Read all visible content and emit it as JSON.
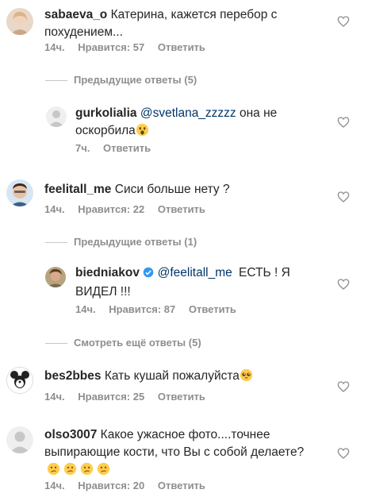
{
  "comments": [
    {
      "username": "sabaeva_o",
      "text": "Катерина, кажется перебор с похудением...",
      "time": "14ч.",
      "likes": "Нравится: 57",
      "reply": "Ответить"
    },
    {
      "username": "gurkolialia",
      "mention": "@svetlana_zzzzz",
      "text": "она не оскорбила",
      "time": "7ч.",
      "reply": "Ответить"
    },
    {
      "username": "feelitall_me",
      "text": "Сиси больше нету ?",
      "time": "14ч.",
      "likes": "Нравится: 22",
      "reply": "Ответить"
    },
    {
      "username": "biedniakov",
      "mention": "@feelitall_me",
      "text": "ЕСТЬ ! Я ВИДЕЛ !!!",
      "time": "14ч.",
      "likes": "Нравится: 87",
      "reply": "Ответить"
    },
    {
      "username": "bes2bbes",
      "text": "Кать кушай пожалуйста",
      "time": "14ч.",
      "likes": "Нравится: 25",
      "reply": "Ответить"
    },
    {
      "username": "olso3007",
      "text": "Какое ужасное фото....точнее выпирающие кости, что Вы с собой делаете?",
      "time": "14ч.",
      "likes": "Нравится: 20",
      "reply": "Ответить"
    }
  ],
  "dividers": {
    "prev1": "Предыдущие ответы (5)",
    "prev2": "Предыдущие ответы (1)",
    "more": "Смотреть ещё ответы (5)"
  },
  "colors": {
    "mention": "#003569",
    "meta": "#8e8e8e",
    "text": "#262626",
    "verified": "#3897f0"
  },
  "icons": [
    "heart-outline-icon",
    "verified-badge-icon",
    "astonished-emoji-icon",
    "pleading-emoji-icon",
    "confused-emoji-icon"
  ]
}
